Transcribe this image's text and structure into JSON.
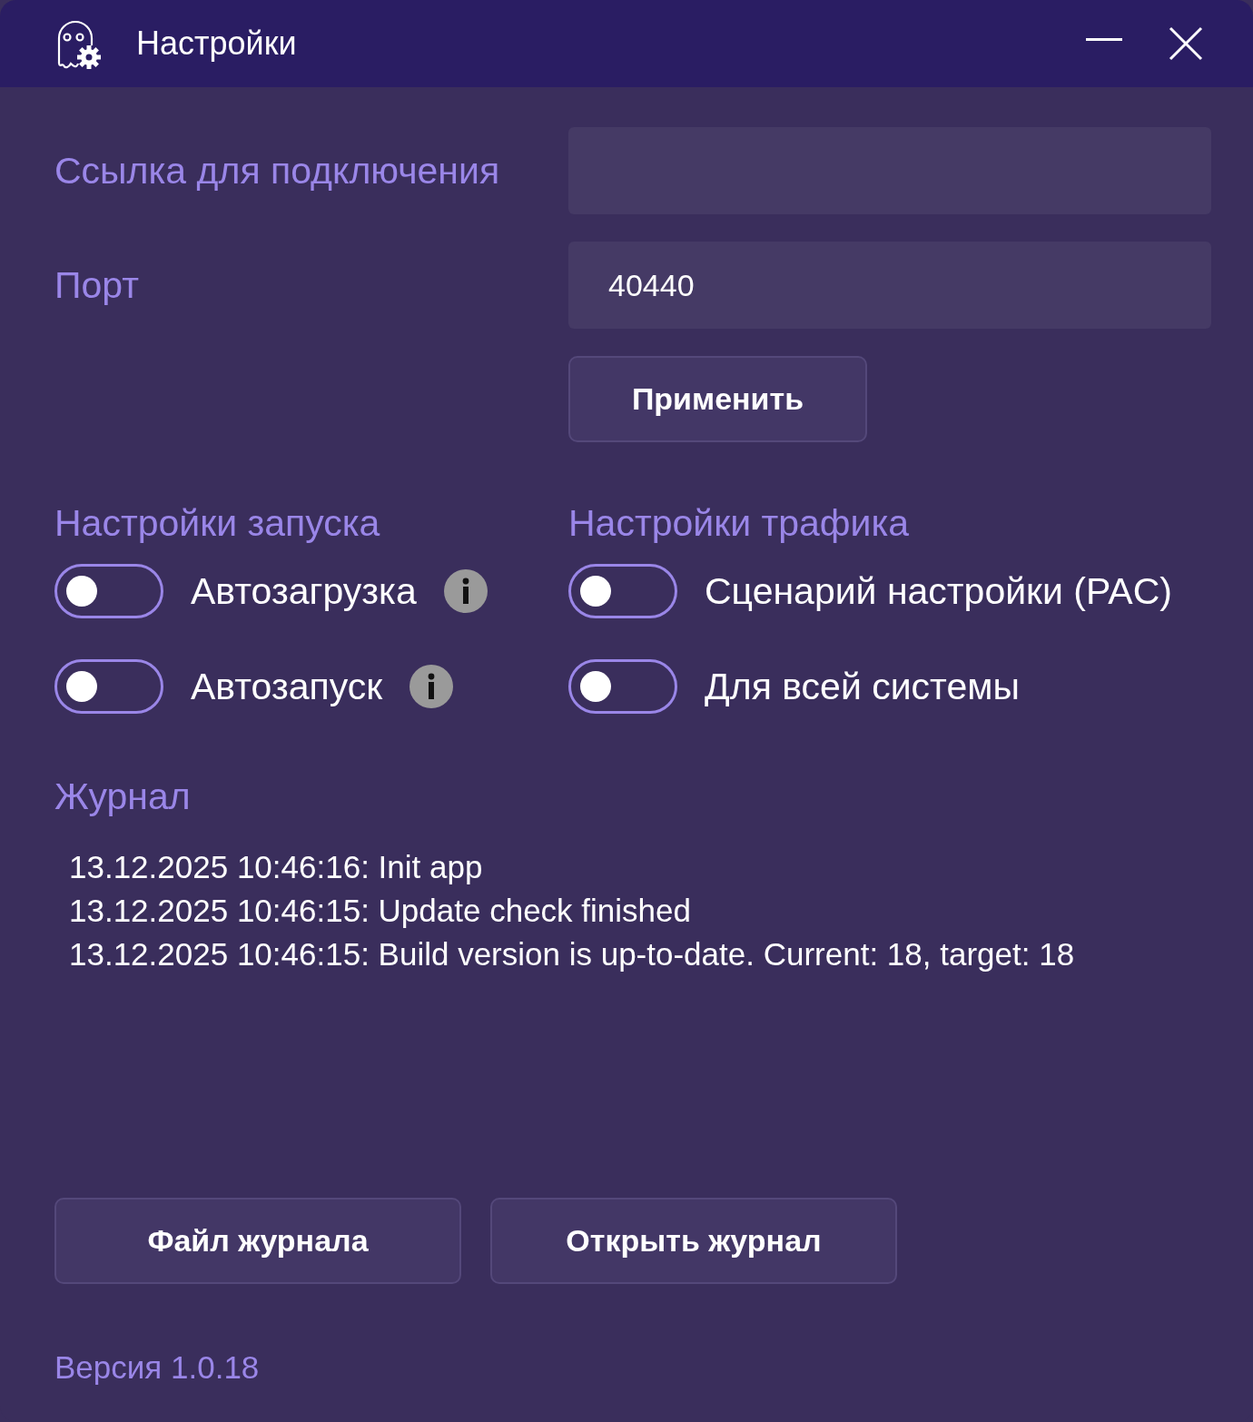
{
  "window": {
    "title": "Настройки"
  },
  "connection": {
    "label": "Ссылка для подключения"
  },
  "port": {
    "label": "Порт",
    "value": "40440"
  },
  "apply_button": "Применить",
  "startup": {
    "heading": "Настройки запуска",
    "toggles": [
      {
        "label": "Автозагрузка",
        "on": false,
        "info": true
      },
      {
        "label": "Автозапуск",
        "on": false,
        "info": true
      }
    ]
  },
  "traffic": {
    "heading": "Настройки трафика",
    "toggles": [
      {
        "label": "Сценарий настройки (PAC)",
        "on": false,
        "info": false
      },
      {
        "label": "Для всей системы",
        "on": false,
        "info": false
      }
    ]
  },
  "log": {
    "heading": "Журнал",
    "lines": [
      "13.12.2025 10:46:16: Init app",
      "13.12.2025 10:46:15: Update check finished",
      "13.12.2025 10:46:15: Build version is up-to-date. Current: 18, target: 18"
    ]
  },
  "buttons": [
    "Файл журнала",
    "Открыть журнал"
  ],
  "version": "Версия 1.0.18"
}
